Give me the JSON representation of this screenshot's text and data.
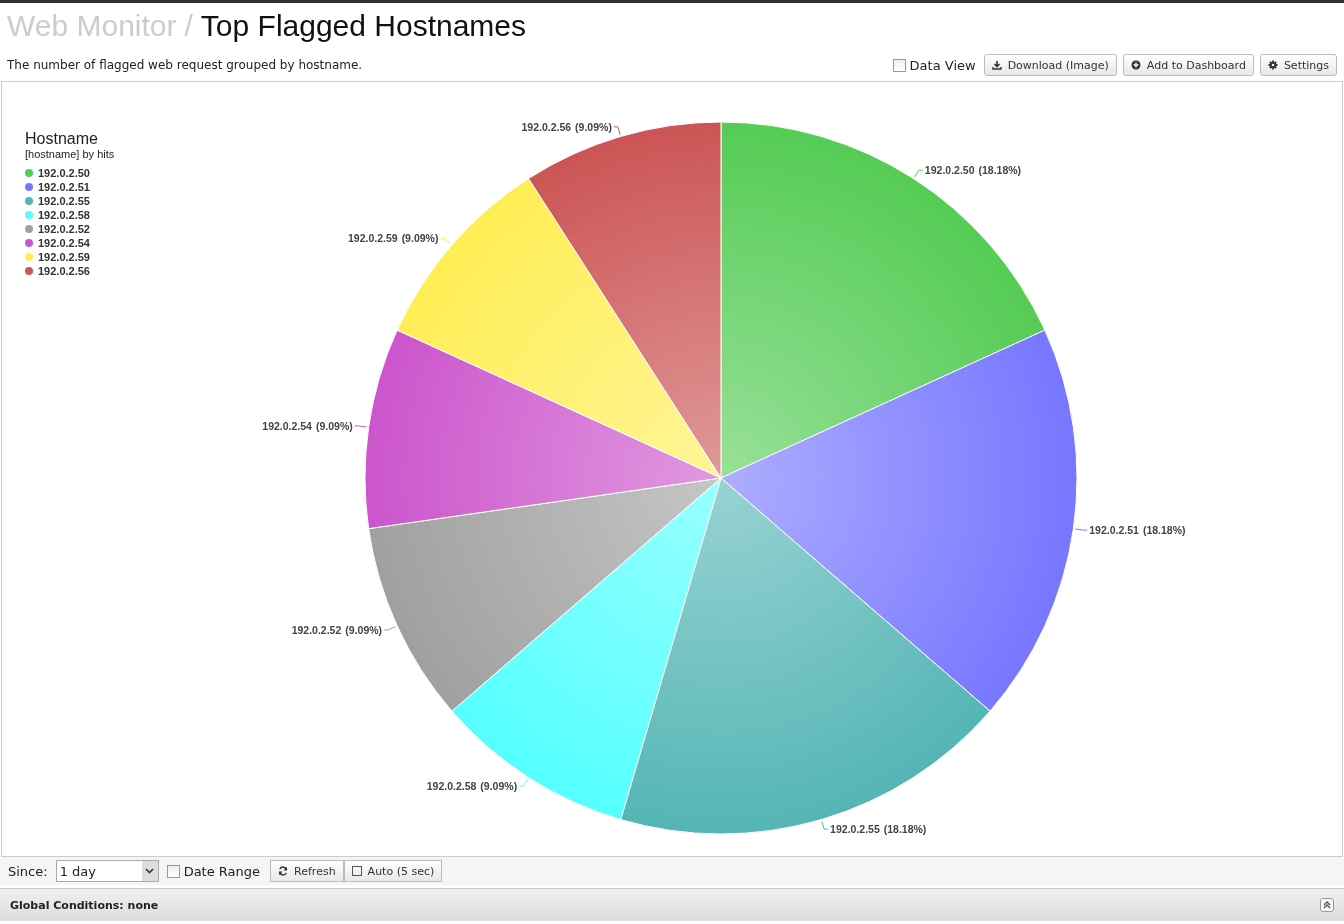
{
  "breadcrumb": {
    "parent": "Web Monitor",
    "separator": "/",
    "title": "Top Flagged Hostnames"
  },
  "description": "The number of flagged web request grouped by hostname.",
  "toolbar": {
    "data_view": {
      "label": "Data View",
      "checked": false
    },
    "buttons": [
      {
        "kind": "download",
        "label": "Download (Image)"
      },
      {
        "kind": "add",
        "label": "Add to Dashboard"
      },
      {
        "kind": "settings",
        "label": "Settings"
      }
    ]
  },
  "legend": {
    "title": "Hostname",
    "subtitle": "[hostname] by hits",
    "items": [
      {
        "label": "192.0.2.50",
        "color": "#55cc55"
      },
      {
        "label": "192.0.2.51",
        "color": "#7777ff"
      },
      {
        "label": "192.0.2.55",
        "color": "#55b5b5"
      },
      {
        "label": "192.0.2.58",
        "color": "#55ffff"
      },
      {
        "label": "192.0.2.52",
        "color": "#a0a0a0"
      },
      {
        "label": "192.0.2.54",
        "color": "#cc55cc"
      },
      {
        "label": "192.0.2.59",
        "color": "#ffee55"
      },
      {
        "label": "192.0.2.56",
        "color": "#cc5555"
      }
    ]
  },
  "chart_data": {
    "type": "pie",
    "categories": [
      "192.0.2.50",
      "192.0.2.51",
      "192.0.2.55",
      "192.0.2.58",
      "192.0.2.52",
      "192.0.2.54",
      "192.0.2.59",
      "192.0.2.56"
    ],
    "values": [
      18.18,
      18.18,
      18.18,
      9.09,
      9.09,
      9.09,
      9.09,
      9.09
    ],
    "value_labels": [
      "(18.18%)",
      "(18.18%)",
      "(18.18%)",
      "(9.09%)",
      "(9.09%)",
      "(9.09%)",
      "(9.09%)",
      "(9.09%)"
    ]
  },
  "footer": {
    "since_label": "Since:",
    "since_value": "1 day",
    "date_range": {
      "label": "Date Range",
      "checked": false
    },
    "refresh": "Refresh",
    "auto": {
      "label": "Auto (5 sec)",
      "checked": false
    }
  },
  "global_conditions": "Global Conditions: none"
}
